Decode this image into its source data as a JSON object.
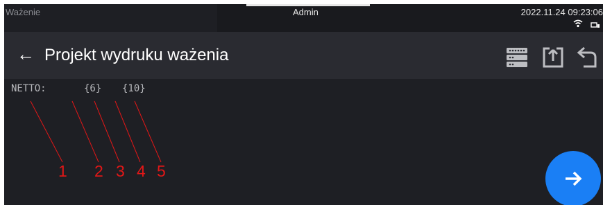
{
  "status": {
    "mode": "Ważenie",
    "user": "Admin",
    "datetime": "2022.11.24 09:23:06",
    "icons": [
      "wifi-icon",
      "device-icon"
    ]
  },
  "header": {
    "back_icon": "arrow-left-icon",
    "title": "Projekt wydruku ważenia",
    "tools": [
      "database-icon",
      "import-icon",
      "export-icon"
    ]
  },
  "template": {
    "label": "NETTO:",
    "var1": "{6}",
    "var2": "{10}"
  },
  "annotations": [
    "1",
    "2",
    "3",
    "4",
    "5"
  ],
  "colors": {
    "background": "#1e1f24",
    "header": "#2a2b31",
    "annotation": "#e11717",
    "accent": "#1a7ff5"
  },
  "fab": {
    "icon": "arrow-right-icon"
  }
}
